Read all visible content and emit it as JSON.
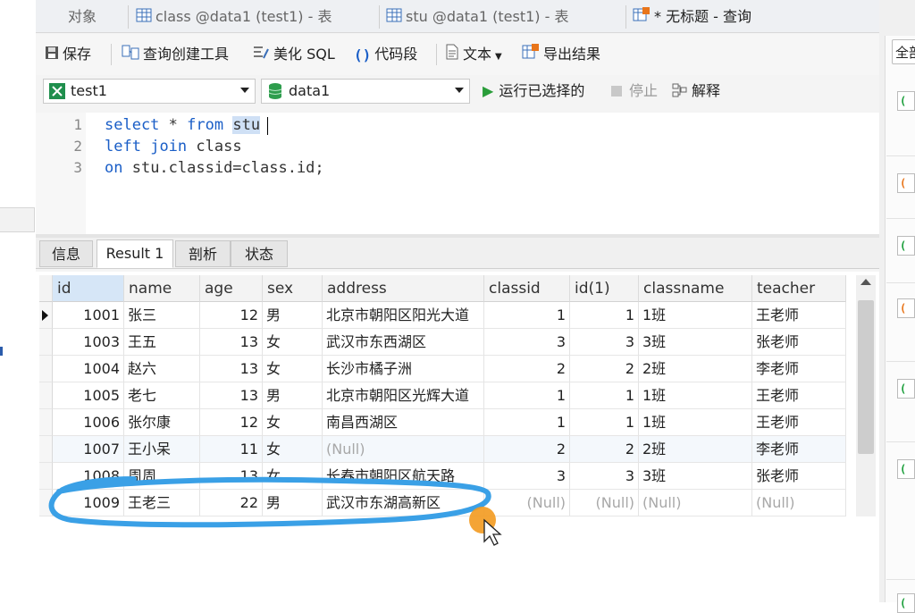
{
  "tabs": [
    {
      "label": "对象"
    },
    {
      "label": "class @data1 (test1) - 表"
    },
    {
      "label": "stu @data1 (test1) - 表"
    },
    {
      "label": "* 无标题 - 查询"
    }
  ],
  "toolbar": {
    "save": "保存",
    "query_builder": "查询创建工具",
    "beautify": "美化 SQL",
    "snippet": "代码段",
    "text": "文本",
    "export": "导出结果"
  },
  "connection": {
    "value": "test1"
  },
  "database": {
    "value": "data1"
  },
  "run_selected": "运行已选择的",
  "stop": "停止",
  "explain": "解释",
  "editor": {
    "line_numbers": [
      "1",
      "2",
      "3"
    ],
    "lines": [
      {
        "kw1": "select",
        "rest1": " * ",
        "kw2": "from",
        "sp": " ",
        "sel": "stu"
      },
      {
        "kw1": "left",
        "sp1": " ",
        "kw2": "join",
        "rest": " class"
      },
      {
        "kw1": "on",
        "rest": " stu.classid=class.id;"
      }
    ]
  },
  "result_tabs": [
    "信息",
    "Result 1",
    "剖析",
    "状态"
  ],
  "grid": {
    "columns": [
      "id",
      "name",
      "age",
      "sex",
      "address",
      "classid",
      "id(1)",
      "classname",
      "teacher"
    ],
    "rows": [
      [
        "1001",
        "张三",
        "12",
        "男",
        "北京市朝阳区阳光大道",
        "1",
        "1",
        "1班",
        "王老师"
      ],
      [
        "1003",
        "王五",
        "13",
        "女",
        "武汉市东西湖区",
        "3",
        "3",
        "3班",
        "张老师"
      ],
      [
        "1004",
        "赵六",
        "13",
        "女",
        "长沙市橘子洲",
        "2",
        "2",
        "2班",
        "李老师"
      ],
      [
        "1005",
        "老七",
        "13",
        "男",
        "北京市朝阳区光辉大道",
        "1",
        "1",
        "1班",
        "王老师"
      ],
      [
        "1006",
        "张尔康",
        "12",
        "女",
        "南昌西湖区",
        "1",
        "1",
        "1班",
        "王老师"
      ],
      [
        "1007",
        "王小呆",
        "11",
        "女",
        "(Null)",
        "2",
        "2",
        "2班",
        "李老师"
      ],
      [
        "1008",
        "周周",
        "13",
        "女",
        "长春市朝阳区航天路",
        "3",
        "3",
        "3班",
        "张老师"
      ],
      [
        "1009",
        "王老三",
        "22",
        "男",
        "武汉市东湖高新区",
        "(Null)",
        "(Null)",
        "(Null)",
        "(Null)"
      ]
    ]
  },
  "right_panel": {
    "button": "全部"
  },
  "colors": {
    "keyword": "#1a5ec7",
    "annotation": "#3aa0e6",
    "cursor_highlight": "#f39a1f"
  }
}
